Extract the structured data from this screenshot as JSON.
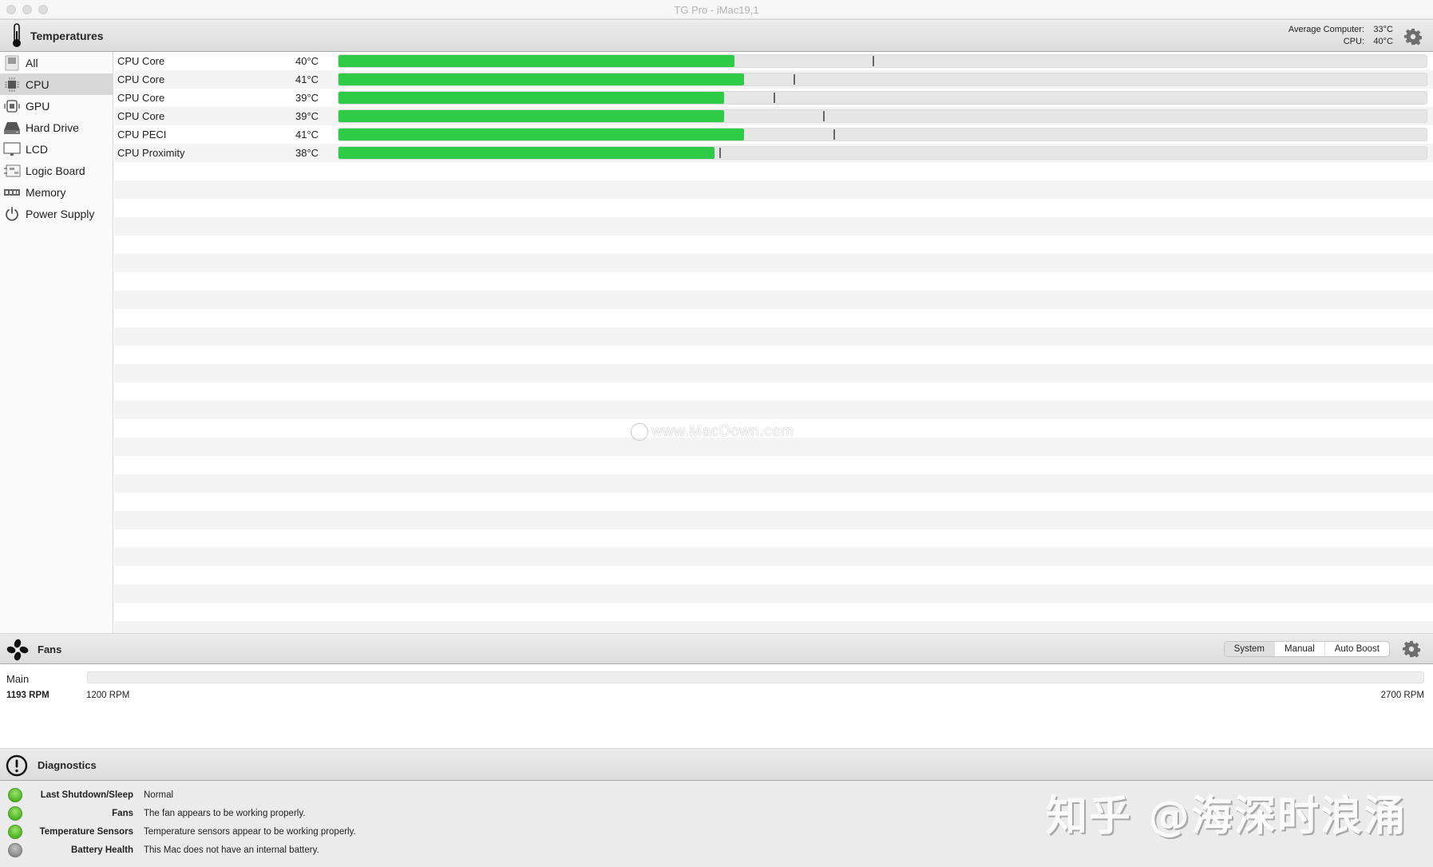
{
  "window": {
    "title": "TG Pro - iMac19,1"
  },
  "temperatures": {
    "header_title": "Temperatures",
    "summary": [
      {
        "label": "Average Computer:",
        "value": "33°C"
      },
      {
        "label": "CPU:",
        "value": "40°C"
      }
    ],
    "scale_max_c": 110,
    "sidebar": [
      {
        "label": "All",
        "icon": "computer-icon",
        "selected": false
      },
      {
        "label": "CPU",
        "icon": "cpu-chip-icon",
        "selected": true
      },
      {
        "label": "GPU",
        "icon": "gpu-icon",
        "selected": false
      },
      {
        "label": "Hard Drive",
        "icon": "hard-drive-icon",
        "selected": false
      },
      {
        "label": "LCD",
        "icon": "monitor-icon",
        "selected": false
      },
      {
        "label": "Logic Board",
        "icon": "logic-board-icon",
        "selected": false
      },
      {
        "label": "Memory",
        "icon": "memory-icon",
        "selected": false
      },
      {
        "label": "Power Supply",
        "icon": "power-icon",
        "selected": false
      }
    ],
    "sensors": [
      {
        "name": "CPU Core",
        "temp": "40°C",
        "value": 40,
        "max": 54
      },
      {
        "name": "CPU Core",
        "temp": "41°C",
        "value": 41,
        "max": 46
      },
      {
        "name": "CPU Core",
        "temp": "39°C",
        "value": 39,
        "max": 44
      },
      {
        "name": "CPU Core",
        "temp": "39°C",
        "value": 39,
        "max": 49
      },
      {
        "name": "CPU PECI",
        "temp": "41°C",
        "value": 41,
        "max": 50
      },
      {
        "name": "CPU Proximity",
        "temp": "38°C",
        "value": 38,
        "max": 38.5
      }
    ],
    "bar_color": "#2ecb46"
  },
  "watermark_mid": "www.MacDown.com",
  "fans": {
    "header_title": "Fans",
    "modes": [
      {
        "label": "System",
        "active": true
      },
      {
        "label": "Manual",
        "active": false
      },
      {
        "label": "Auto Boost",
        "active": false
      }
    ],
    "items": [
      {
        "name": "Main",
        "rpm": "1193 RPM",
        "min": "1200 RPM",
        "max": "2700 RPM"
      }
    ]
  },
  "diagnostics": {
    "header_title": "Diagnostics",
    "items": [
      {
        "label": "Last Shutdown/Sleep",
        "value": "Normal",
        "status": "ok"
      },
      {
        "label": "Fans",
        "value": "The fan appears to be working properly.",
        "status": "ok"
      },
      {
        "label": "Temperature Sensors",
        "value": "Temperature sensors appear to be working properly.",
        "status": "ok"
      },
      {
        "label": "Battery Health",
        "value": "This Mac does not have an internal battery.",
        "status": "na"
      }
    ]
  },
  "watermark_corner": "知乎 @海深时浪涌"
}
